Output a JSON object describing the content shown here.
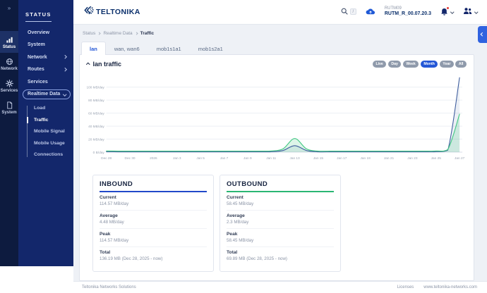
{
  "colors": {
    "accent_blue": "#2457d6",
    "sidebar_blue": "#13276b",
    "rail_navy": "#0d1b3f",
    "brand_navy": "#0a2f6b",
    "inbound_blue": "#3f5e9e",
    "outbound_green": "#42c882",
    "inbound_underline": "#2149c9",
    "outbound_underline": "#2bb673",
    "alert_red": "#e53935"
  },
  "rail": {
    "toggle_icon": "»",
    "items": [
      {
        "label": "Status",
        "icon": "bar-chart-icon",
        "active": true
      },
      {
        "label": "Network",
        "icon": "globe-icon",
        "active": false
      },
      {
        "label": "Services",
        "icon": "gear-icon",
        "active": false
      },
      {
        "label": "System",
        "icon": "document-icon",
        "active": false
      }
    ]
  },
  "sidebar": {
    "section_title": "STATUS",
    "items": [
      {
        "label": "Overview"
      },
      {
        "label": "System"
      },
      {
        "label": "Network",
        "chevron": "right"
      },
      {
        "label": "Routes",
        "chevron": "right"
      },
      {
        "label": "Services"
      },
      {
        "label": "Realtime Data",
        "chevron": "down",
        "selected": true
      }
    ],
    "subitems": [
      {
        "label": "Load",
        "active": false
      },
      {
        "label": "Traffic",
        "active": true
      },
      {
        "label": "Mobile Signal",
        "active": false
      },
      {
        "label": "Mobile Usage",
        "active": false
      },
      {
        "label": "Connections",
        "active": false
      }
    ]
  },
  "header": {
    "logo_text": "TELTONIKA",
    "search_shortcut": "/",
    "device_name": "RUTM09",
    "firmware_version": "RUTM_R_00.07.20.3"
  },
  "breadcrumb": {
    "items": [
      {
        "label": "Status",
        "current": false
      },
      {
        "label": "Realtime Data",
        "current": false
      },
      {
        "label": "Traffic",
        "current": true
      }
    ]
  },
  "tabs": [
    {
      "label": "lan",
      "active": true
    },
    {
      "label": "wan, wan6",
      "active": false
    },
    {
      "label": "mob1s1a1",
      "active": false
    },
    {
      "label": "mob1s2a1",
      "active": false
    }
  ],
  "traffic_section": {
    "title": "lan traffic",
    "range_buttons": [
      {
        "label": "Live",
        "active": false
      },
      {
        "label": "Day",
        "active": false
      },
      {
        "label": "Week",
        "active": false
      },
      {
        "label": "Month",
        "active": true
      },
      {
        "label": "Year",
        "active": false
      },
      {
        "label": "All",
        "active": false
      }
    ]
  },
  "chart_data": {
    "type": "area",
    "title": "lan traffic",
    "unit": "MB/day",
    "x": [
      "Dec 28",
      "Dec 29",
      "Dec 30",
      "Dec 31",
      "Jan 1",
      "Jan 2",
      "Jan 3",
      "Jan 4",
      "Jan 5",
      "Jan 6",
      "Jan 7",
      "Jan 8",
      "Jan 9",
      "Jan 10",
      "Jan 11",
      "Jan 12",
      "Jan 13",
      "Jan 14",
      "Jan 15",
      "Jan 16",
      "Jan 17",
      "Jan 18",
      "Jan 19",
      "Jan 20",
      "Jan 21",
      "Jan 22",
      "Jan 23",
      "Jan 24",
      "Jan 25",
      "Jan 26",
      "Jan 27"
    ],
    "x_tick_labels": [
      "Dec 28",
      "Dec 30",
      "2026",
      "Jan 3",
      "Jan 5",
      "Jan 7",
      "Jan 9",
      "Jan 11",
      "Jan 13",
      "Jan 15",
      "Jan 17",
      "Jan 19",
      "Jan 21",
      "Jan 23",
      "Jan 25",
      "Jan 27"
    ],
    "y_tick_labels": [
      "0 B/day",
      "20 MB/day",
      "40 MB/day",
      "60 MB/day",
      "80 MB/day",
      "100 MB/day"
    ],
    "y_tick_values": [
      0,
      20,
      40,
      60,
      80,
      100
    ],
    "ylim": [
      0,
      117
    ],
    "grid": true,
    "legend": "none",
    "series": [
      {
        "name": "inbound",
        "color": "#3f5e9e",
        "values": [
          0.6,
          0.5,
          0.5,
          0.5,
          0.5,
          0.5,
          0.5,
          0.5,
          0.5,
          0.5,
          0.5,
          0.5,
          0.5,
          0.5,
          0.6,
          2.5,
          10,
          2.5,
          0.5,
          0.5,
          0.5,
          0.5,
          0.5,
          0.5,
          0.5,
          0.5,
          0.5,
          0.5,
          0.6,
          3,
          114.57
        ]
      },
      {
        "name": "outbound",
        "color": "#42c882",
        "values": [
          1.8,
          1.6,
          1.6,
          1.6,
          1.6,
          1.6,
          1.6,
          1.6,
          1.6,
          1.6,
          1.6,
          1.6,
          1.6,
          1.6,
          1.8,
          5,
          21,
          5,
          1.6,
          1.6,
          1.6,
          1.6,
          1.6,
          1.6,
          1.6,
          1.6,
          1.6,
          1.6,
          1.8,
          4,
          58.45
        ]
      }
    ]
  },
  "stats_cards": [
    {
      "title": "INBOUND",
      "underline_color": "#2149c9",
      "rows": [
        {
          "label": "Current",
          "value": "114.57 MB/day"
        },
        {
          "label": "Average",
          "value": "4.48 MB/day"
        },
        {
          "label": "Peak",
          "value": "114.57 MB/day"
        },
        {
          "label": "Total",
          "value": "136.19 MB (Dec 28, 2025 - now)"
        }
      ]
    },
    {
      "title": "OUTBOUND",
      "underline_color": "#2bb673",
      "rows": [
        {
          "label": "Current",
          "value": "58.45 MB/day"
        },
        {
          "label": "Average",
          "value": "2.3 MB/day"
        },
        {
          "label": "Peak",
          "value": "58.45 MB/day"
        },
        {
          "label": "Total",
          "value": "69.89 MB (Dec 28, 2025 - now)"
        }
      ]
    }
  ],
  "footer": {
    "company": "Teltonika Networks Solutions",
    "links": [
      {
        "label": "Licenses"
      },
      {
        "label": "www.teltonika-networks.com"
      }
    ]
  }
}
